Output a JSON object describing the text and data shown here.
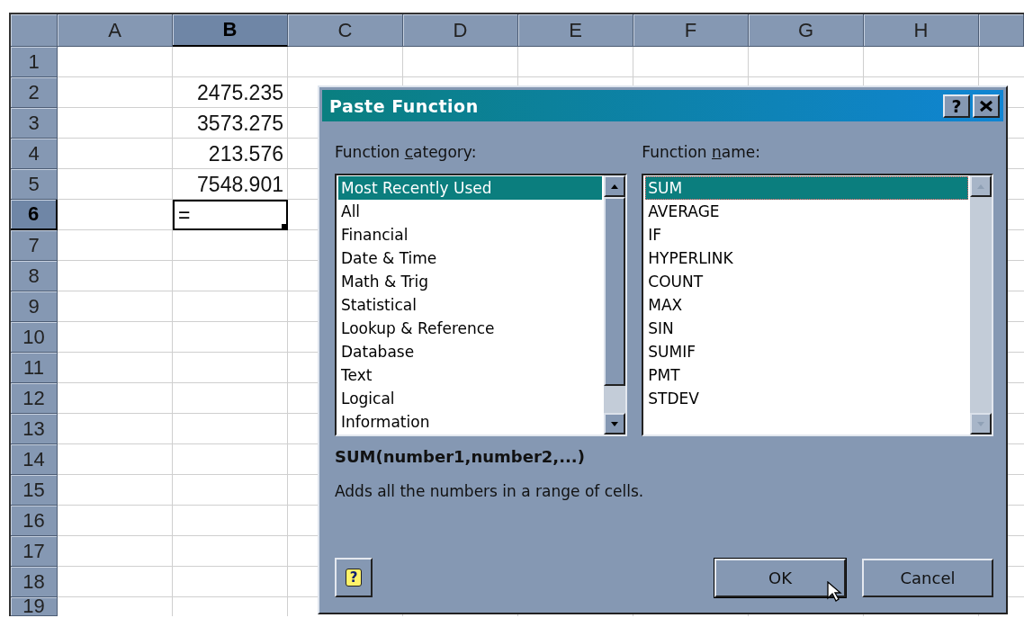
{
  "sheet": {
    "columns": [
      {
        "label": "A",
        "selected": false
      },
      {
        "label": "B",
        "selected": true
      },
      {
        "label": "C",
        "selected": false
      },
      {
        "label": "D",
        "selected": false
      },
      {
        "label": "E",
        "selected": false
      },
      {
        "label": "F",
        "selected": false
      },
      {
        "label": "G",
        "selected": false
      },
      {
        "label": "H",
        "selected": false
      }
    ],
    "rows": [
      {
        "label": "1",
        "selected": false,
        "cells": {}
      },
      {
        "label": "2",
        "selected": false,
        "cells": {
          "B": {
            "text": "2475.235",
            "active": false
          }
        }
      },
      {
        "label": "3",
        "selected": false,
        "cells": {
          "B": {
            "text": "3573.275",
            "active": false
          }
        }
      },
      {
        "label": "4",
        "selected": false,
        "cells": {
          "B": {
            "text": "213.576",
            "active": false
          }
        }
      },
      {
        "label": "5",
        "selected": false,
        "cells": {
          "B": {
            "text": "7548.901",
            "active": false
          }
        }
      },
      {
        "label": "6",
        "selected": true,
        "cells": {
          "B": {
            "text": "=",
            "active": true
          }
        }
      },
      {
        "label": "7",
        "selected": false,
        "cells": {}
      },
      {
        "label": "8",
        "selected": false,
        "cells": {}
      },
      {
        "label": "9",
        "selected": false,
        "cells": {}
      },
      {
        "label": "10",
        "selected": false,
        "cells": {}
      },
      {
        "label": "11",
        "selected": false,
        "cells": {}
      },
      {
        "label": "12",
        "selected": false,
        "cells": {}
      },
      {
        "label": "13",
        "selected": false,
        "cells": {}
      },
      {
        "label": "14",
        "selected": false,
        "cells": {}
      },
      {
        "label": "15",
        "selected": false,
        "cells": {}
      },
      {
        "label": "16",
        "selected": false,
        "cells": {}
      },
      {
        "label": "17",
        "selected": false,
        "cells": {}
      },
      {
        "label": "18",
        "selected": false,
        "cells": {}
      },
      {
        "label": "19",
        "selected": false,
        "cells": {}
      }
    ]
  },
  "dialog": {
    "title": "Paste Function",
    "help_button": "?",
    "lists": [
      {
        "label": [
          "Function ",
          "c",
          "ategory:"
        ],
        "scrollbar_enabled": true,
        "items": [
          {
            "text": "Most Recently Used",
            "selected": true
          },
          {
            "text": "All",
            "selected": false
          },
          {
            "text": "Financial",
            "selected": false
          },
          {
            "text": "Date & Time",
            "selected": false
          },
          {
            "text": "Math & Trig",
            "selected": false
          },
          {
            "text": "Statistical",
            "selected": false
          },
          {
            "text": "Lookup & Reference",
            "selected": false
          },
          {
            "text": "Database",
            "selected": false
          },
          {
            "text": "Text",
            "selected": false
          },
          {
            "text": "Logical",
            "selected": false
          },
          {
            "text": "Information",
            "selected": false
          }
        ]
      },
      {
        "label": [
          "Function ",
          "n",
          "ame:"
        ],
        "scrollbar_enabled": false,
        "items": [
          {
            "text": "SUM",
            "selected": true
          },
          {
            "text": "AVERAGE",
            "selected": false
          },
          {
            "text": "IF",
            "selected": false
          },
          {
            "text": "HYPERLINK",
            "selected": false
          },
          {
            "text": "COUNT",
            "selected": false
          },
          {
            "text": "MAX",
            "selected": false
          },
          {
            "text": "SIN",
            "selected": false
          },
          {
            "text": "SUMIF",
            "selected": false
          },
          {
            "text": "PMT",
            "selected": false
          },
          {
            "text": "STDEV",
            "selected": false
          }
        ]
      }
    ],
    "signature": "SUM(number1,number2,...)",
    "description": "Adds all the numbers in a range of cells.",
    "assistant_button": "?",
    "buttons": [
      {
        "label": "OK",
        "hovered": true
      },
      {
        "label": "Cancel",
        "hovered": false
      }
    ]
  }
}
